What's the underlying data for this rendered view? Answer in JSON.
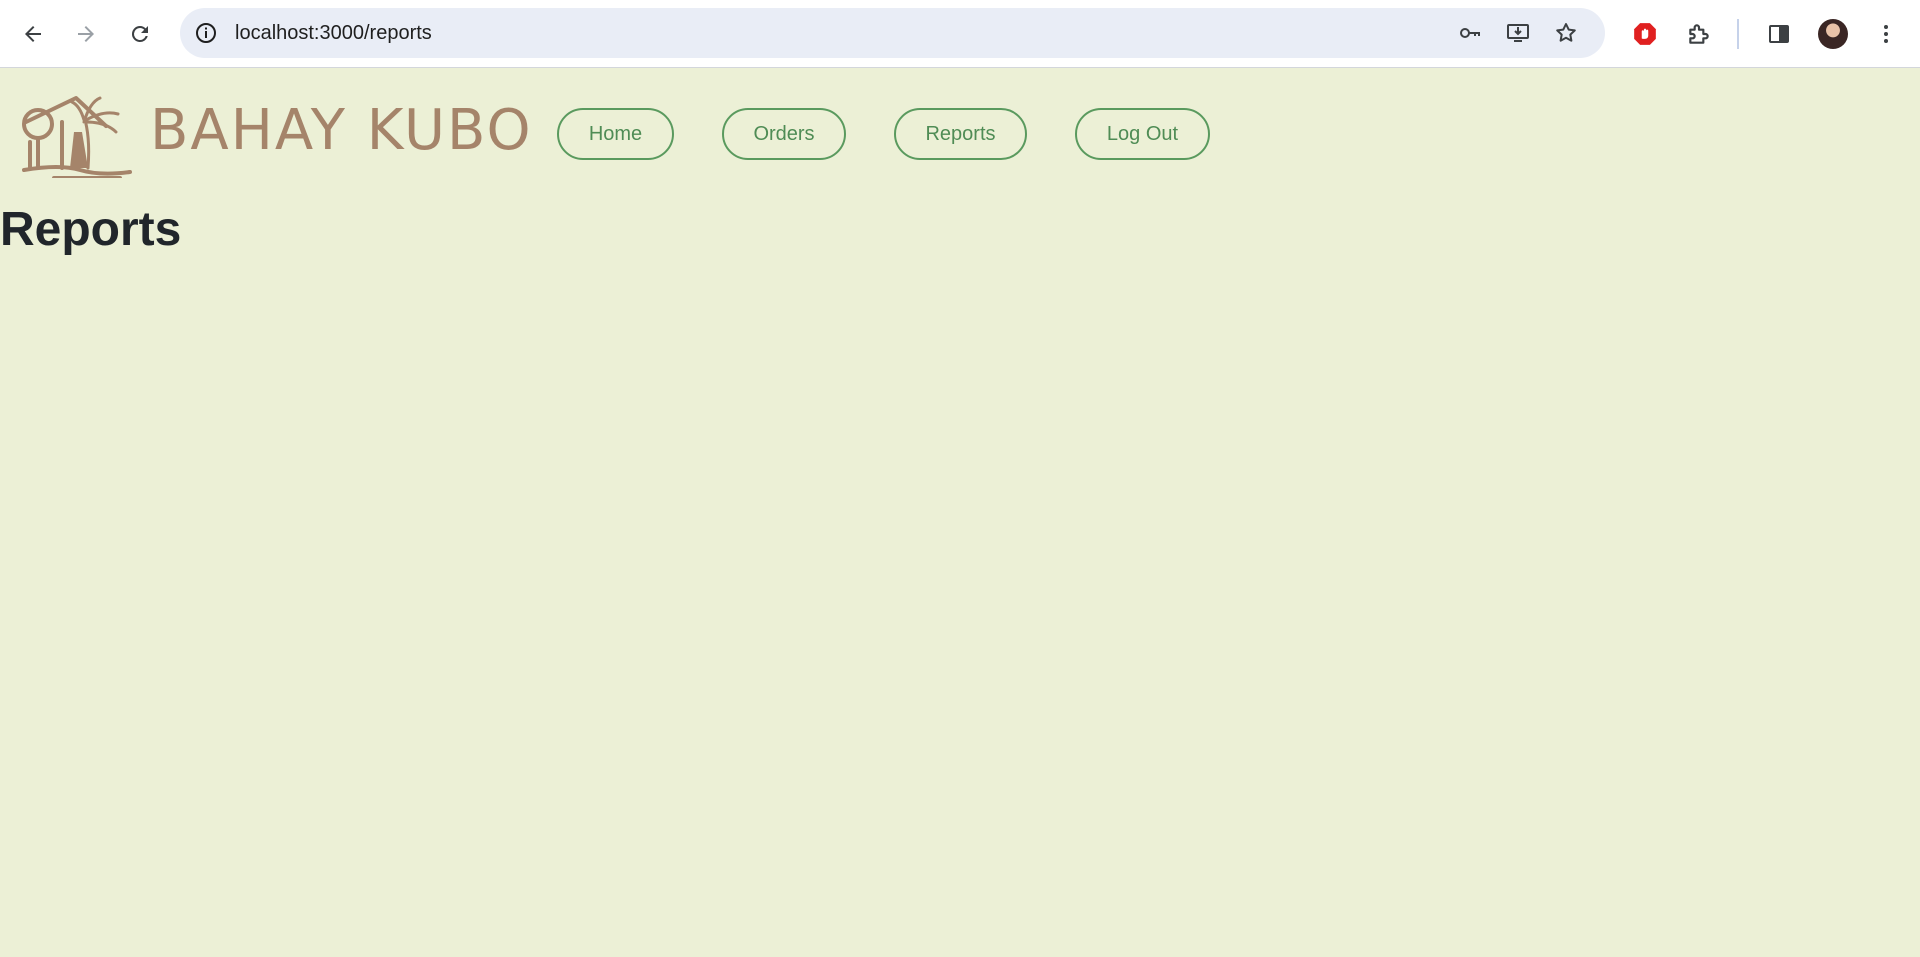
{
  "browser": {
    "url": "localhost:3000/reports",
    "icons": [
      "back-icon",
      "forward-icon",
      "reload-icon",
      "site-info-icon",
      "password-key-icon",
      "install-app-icon",
      "bookmark-star-icon",
      "adblock-icon",
      "extensions-icon",
      "side-panel-icon",
      "profile-avatar",
      "menu-icon"
    ]
  },
  "header": {
    "brand": "BAHAY KUBO",
    "nav": [
      "Home",
      "Orders",
      "Reports",
      "Log Out"
    ]
  },
  "main": {
    "title": "Reports"
  },
  "colors": {
    "page_bg": "#ecf0d6",
    "brand": "#a5846a",
    "nav_accent": "#5a9a5e",
    "title": "#21262b"
  }
}
